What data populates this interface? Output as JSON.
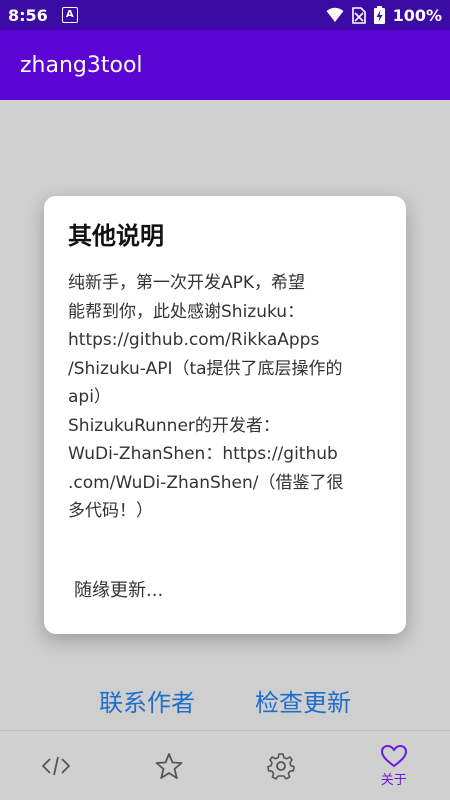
{
  "status_bar": {
    "time": "8:56",
    "notification_icon": "a-badge-icon",
    "battery": "100%"
  },
  "app_bar": {
    "title": "zhang3tool"
  },
  "dialog": {
    "title": "其他说明",
    "message": "纯新手，第一次开发APK，希望\n能帮到你，此处感谢Shizuku：\nhttps://github.com/RikkaApps\n/Shizuku-API（ta提供了底层操作的\napi）\n ShizukuRunner的开发者：\nWuDi-ZhanShen：https://github\n.com/WuDi-ZhanShen/（借鉴了很\n多代码！）",
    "footer": "随缘更新..."
  },
  "links": {
    "contact_author": "联系作者",
    "check_update": "检查更新"
  },
  "bottom_nav": {
    "items": [
      {
        "icon": "code-icon",
        "label": ""
      },
      {
        "icon": "star-icon",
        "label": ""
      },
      {
        "icon": "gear-icon",
        "label": ""
      },
      {
        "icon": "heart-icon",
        "label": "关于"
      }
    ],
    "selected_index": 3
  },
  "colors": {
    "status_bar": "#3c0aa5",
    "app_bar": "#5a05d4",
    "accent": "#6a1bd8",
    "link": "#1e6ecc"
  }
}
